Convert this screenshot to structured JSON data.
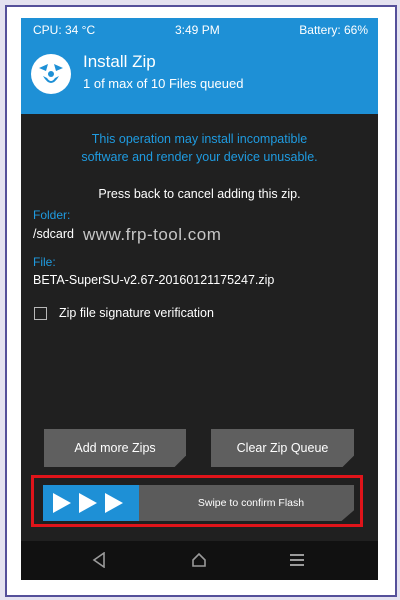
{
  "status_bar": {
    "cpu": "CPU: 34 °C",
    "time": "3:49 PM",
    "battery": "Battery: 66%"
  },
  "header": {
    "title": "Install Zip",
    "subtitle": "1 of max of 10 Files queued"
  },
  "message": {
    "warning_line1": "This operation may install incompatible",
    "warning_line2": "software and render your device unusable.",
    "instruction": "Press back to cancel adding this zip."
  },
  "folder": {
    "label": "Folder:",
    "value": "/sdcard"
  },
  "file": {
    "label": "File:",
    "value": "BETA-SuperSU-v2.67-20160121175247.zip"
  },
  "watermark": "www.frp-tool.com",
  "signature_checkbox": {
    "label": "Zip file signature verification",
    "checked": false
  },
  "buttons": {
    "add_more": "Add more Zips",
    "clear_queue": "Clear Zip Queue"
  },
  "swipe": {
    "label": "Swipe to confirm Flash"
  },
  "colors": {
    "accent": "#1e90d6",
    "highlight_box": "#e0141a",
    "background": "#202020"
  },
  "nav_icons": [
    "back-icon",
    "home-icon",
    "menu-icon"
  ]
}
